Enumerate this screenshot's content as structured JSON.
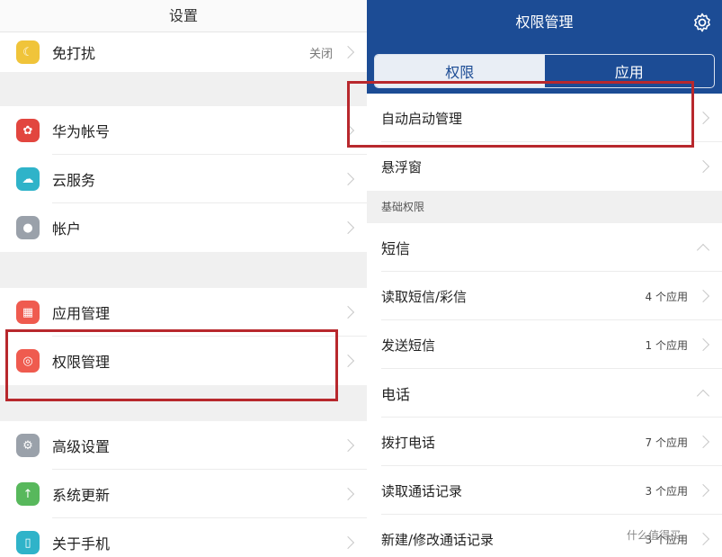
{
  "left": {
    "title": "设置",
    "dnd": {
      "label": "免打扰",
      "value": "关闭"
    },
    "account_group": [
      {
        "label": "华为帐号",
        "icon": "huawei-icon",
        "color": "#e2463f"
      },
      {
        "label": "云服务",
        "icon": "cloud-icon",
        "color": "#2fb3c9"
      },
      {
        "label": "帐户",
        "icon": "user-icon",
        "color": "#9aa1aa"
      }
    ],
    "app_group": [
      {
        "label": "应用管理",
        "icon": "grid-icon",
        "color": "#ef5b4f"
      },
      {
        "label": "权限管理",
        "icon": "shield-icon",
        "color": "#ef5b4f"
      }
    ],
    "system_group": [
      {
        "label": "高级设置",
        "icon": "gear-icon",
        "color": "#9aa1aa"
      },
      {
        "label": "系统更新",
        "icon": "arrow-up-icon",
        "color": "#58b85c"
      },
      {
        "label": "关于手机",
        "icon": "phone-icon",
        "color": "#2fb3c9"
      }
    ]
  },
  "right": {
    "title": "权限管理",
    "tabs": [
      "权限",
      "应用"
    ],
    "rows": [
      "自动启动管理",
      "悬浮窗"
    ],
    "section": "基础权限",
    "sms": {
      "title": "短信",
      "items": [
        {
          "label": "读取短信/彩信",
          "count": "4 个应用"
        },
        {
          "label": "发送短信",
          "count": "1 个应用"
        }
      ]
    },
    "phone": {
      "title": "电话",
      "items": [
        {
          "label": "拨打电话",
          "count": "7 个应用"
        },
        {
          "label": "读取通话记录",
          "count": "3 个应用"
        },
        {
          "label": "新建/修改通话记录",
          "count": "3 个应用"
        }
      ]
    },
    "watermark": "什么值得买"
  },
  "colors": {
    "brand": "#1c4c95",
    "highlight": "#b8282d"
  }
}
